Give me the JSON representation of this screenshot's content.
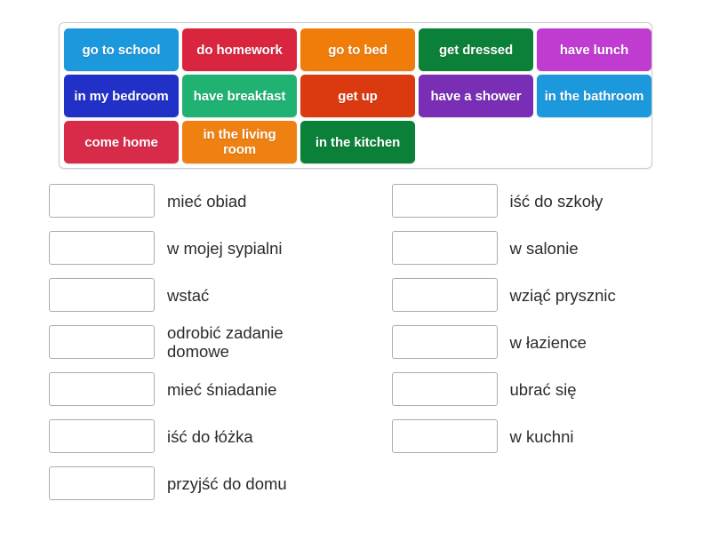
{
  "word_bank": {
    "name": "word-bank",
    "rows": [
      [
        {
          "label": "go to school",
          "color": "#1C98DC"
        },
        {
          "label": "do homework",
          "color": "#D9253D"
        },
        {
          "label": "go to bed",
          "color": "#F07C0A"
        },
        {
          "label": "get dressed",
          "color": "#0B8038"
        },
        {
          "label": "have lunch",
          "color": "#C03BD0"
        }
      ],
      [
        {
          "label": "in my bedroom",
          "color": "#2130C6"
        },
        {
          "label": "have breakfast",
          "color": "#20B272"
        },
        {
          "label": "get up",
          "color": "#DB3A11"
        },
        {
          "label": "have a shower",
          "color": "#7A2EB5"
        },
        {
          "label": "in the bathroom",
          "color": "#1C98DC"
        }
      ],
      [
        {
          "label": "come home",
          "color": "#D82B4A"
        },
        {
          "label": "in the living room",
          "color": "#EF8012"
        },
        {
          "label": "in the kitchen",
          "color": "#0B8038"
        }
      ]
    ]
  },
  "answers": {
    "left_column": [
      {
        "text": "mieć obiad"
      },
      {
        "text": "w mojej sypialni"
      },
      {
        "text": "wstać"
      },
      {
        "text": "odrobić zadanie domowe"
      },
      {
        "text": "mieć śniadanie"
      },
      {
        "text": "iść do łóżka"
      },
      {
        "text": "przyjść do domu"
      }
    ],
    "right_column": [
      {
        "text": "iść do szkoły"
      },
      {
        "text": "w salonie"
      },
      {
        "text": "wziąć prysznic"
      },
      {
        "text": "w łazience"
      },
      {
        "text": "ubrać się"
      },
      {
        "text": "w kuchni"
      }
    ]
  }
}
